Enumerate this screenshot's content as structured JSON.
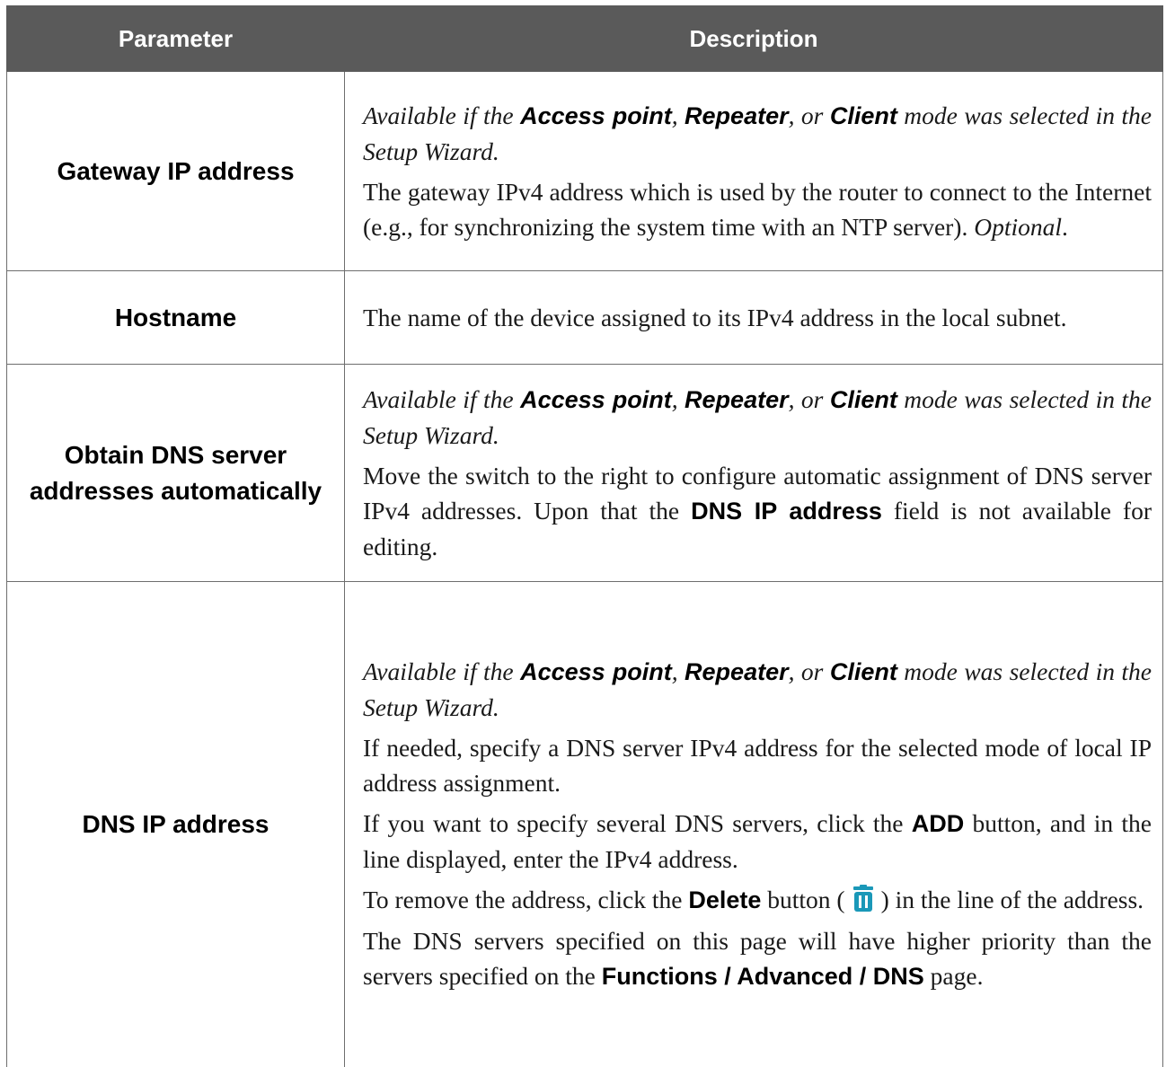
{
  "header": {
    "parameter": "Parameter",
    "description": "Description"
  },
  "rows": {
    "gateway": {
      "name": "Gateway IP address",
      "avail": [
        "Available if the ",
        "Access point",
        ", ",
        "Repeater",
        ", or ",
        "Client",
        " mode was selected in the Setup Wizard."
      ],
      "desc": "The gateway IPv4 address which is used by the router to connect to the Internet (e.g., for synchronizing the system time with an NTP server). ",
      "optional": "Optional",
      "period": "."
    },
    "hostname": {
      "name": "Hostname",
      "desc": "The name of the device assigned to its IPv4 address in the local subnet."
    },
    "obtain_dns": {
      "name": "Obtain DNS server addresses automatically",
      "avail": [
        "Available if the ",
        "Access point",
        ", ",
        "Repeater",
        ", or ",
        "Client",
        " mode was selected in the Setup Wizard."
      ],
      "desc_1": "Move the switch to the right to configure automatic assignment of DNS server IPv4 addresses. Upon that the ",
      "desc_bold": "DNS IP address",
      "desc_2": " field is not available for editing."
    },
    "dns_ip": {
      "name": "DNS IP address",
      "avail": [
        "Available if the ",
        "Access point",
        ", ",
        "Repeater",
        ", or ",
        "Client",
        " mode was selected in the Setup Wizard."
      ],
      "p1": "If needed, specify a DNS server IPv4 address for the selected mode of local IP address assignment.",
      "p2_1": "If you want to specify several DNS servers, click the ",
      "p2_bold": "ADD",
      "p2_2": " button, and in the line displayed, enter the IPv4 address.",
      "p3_1": "To remove the address, click the ",
      "p3_bold": "Delete",
      "p3_2": " button (",
      "p3_3": ") in the line of the address.",
      "p4_1": "The DNS servers specified on this page will have higher priority than the servers specified on the ",
      "p4_bold": "Functions / Advanced / DNS",
      "p4_2": " page."
    }
  },
  "colors": {
    "header_bg": "#5a5a5a",
    "icon": "#1a98b8"
  },
  "icons": {
    "delete": "trash-icon"
  }
}
